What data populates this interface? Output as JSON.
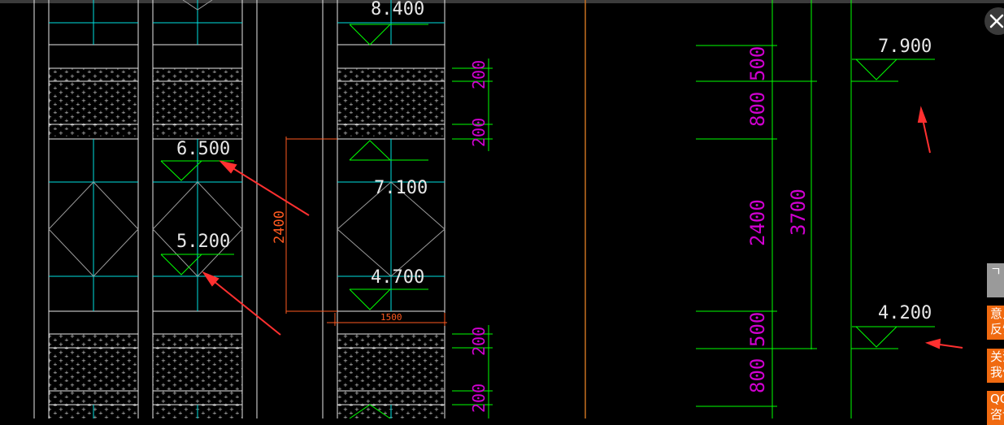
{
  "drawing": {
    "elevations": {
      "e8400": "8.400",
      "e6500": "6.500",
      "e5200": "5.200",
      "e7100": "7.100",
      "e4700": "4.700",
      "e7900": "7.900",
      "e4200": "4.200"
    },
    "dims": {
      "d200a": "200",
      "d200b": "200",
      "d200c": "200",
      "d200d": "200",
      "d2400_red": "2400",
      "d1500": "1500",
      "d500a": "500",
      "d800a": "800",
      "d2400": "2400",
      "d3700": "3700",
      "d500b": "500",
      "d800b": "800"
    }
  },
  "sidebar": {
    "scroll_top_label": "ㄱ",
    "feedback_label": "意见反馈",
    "follow_label": "关注我们",
    "qq_label": "QQ咨询"
  },
  "colors": {
    "green": "#00ff00",
    "cyan": "#00e0e0",
    "white": "#e8e8e8",
    "magenta": "#d000d0",
    "red": "#ff3030",
    "orange_line": "#c87020",
    "accent_orange": "#f06a10"
  },
  "icons": {
    "close": "close-icon"
  }
}
